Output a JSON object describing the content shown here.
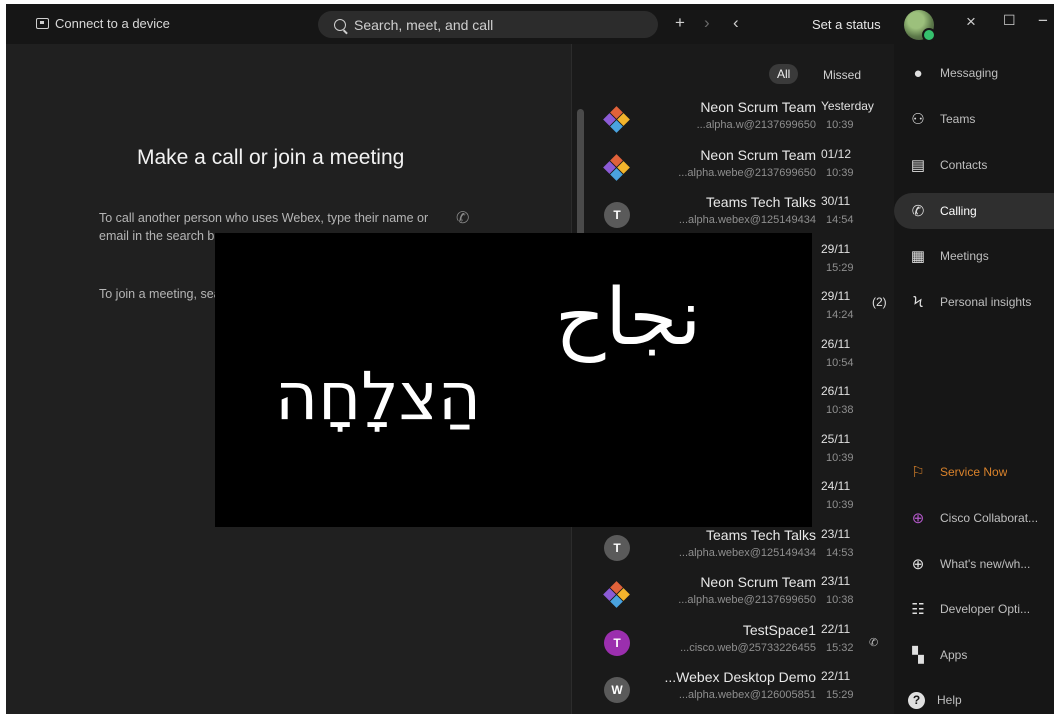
{
  "titlebar": {
    "connect_label": "Connect to a device",
    "search_placeholder": "Search, meet, and call",
    "status_label": "Set a status"
  },
  "left": {
    "heading": "Make a call or join a meeting",
    "para1": "To call another person who uses Webex, type their name or email in the search bar.",
    "para2": "To join a meeting, search bar, such as"
  },
  "calls": {
    "filter_all": "All",
    "filter_missed": "Missed",
    "missed_count": "(2)",
    "rows": [
      {
        "name": "Neon Scrum Team",
        "sub": "...alpha.w@2137699650",
        "date": "Yesterday",
        "time": "10:39",
        "avatar": "logo"
      },
      {
        "name": "Neon Scrum Team",
        "sub": "...alpha.webe@2137699650",
        "date": "01/12",
        "time": "10:39",
        "avatar": "logo"
      },
      {
        "name": "Teams Tech Talks",
        "sub": "...alpha.webex@125149434",
        "date": "30/11",
        "time": "14:54",
        "avatar": "T"
      },
      {
        "name": "",
        "sub": "",
        "date": "29/11",
        "time": "15:29",
        "avatar": ""
      },
      {
        "name": "",
        "sub": "",
        "date": "29/11",
        "time": "14:24",
        "avatar": ""
      },
      {
        "name": "",
        "sub": "",
        "date": "26/11",
        "time": "10:54",
        "avatar": ""
      },
      {
        "name": "",
        "sub": "",
        "date": "26/11",
        "time": "10:38",
        "avatar": ""
      },
      {
        "name": "",
        "sub": "",
        "date": "25/11",
        "time": "10:39",
        "avatar": ""
      },
      {
        "name": "",
        "sub": "",
        "date": "24/11",
        "time": "10:39",
        "avatar": ""
      },
      {
        "name": "Teams Tech Talks",
        "sub": "...alpha.webex@125149434",
        "date": "23/11",
        "time": "14:53",
        "avatar": "T"
      },
      {
        "name": "Neon Scrum Team",
        "sub": "...alpha.webe@2137699650",
        "date": "23/11",
        "time": "10:38",
        "avatar": "logo"
      },
      {
        "name": "TestSpace1",
        "sub": "...cisco.web@25733226455",
        "date": "22/11",
        "time": "15:32",
        "avatar": "T"
      },
      {
        "name": "...Webex Desktop Demo",
        "sub": "...alpha.webex@126005851",
        "date": "22/11",
        "time": "15:29",
        "avatar": "W"
      }
    ]
  },
  "nav": {
    "items": [
      {
        "label": "Messaging",
        "icon": "chat-bubble-icon"
      },
      {
        "label": "Teams",
        "icon": "teams-icon"
      },
      {
        "label": "Contacts",
        "icon": "contacts-icon"
      },
      {
        "label": "Calling",
        "icon": "phone-icon"
      },
      {
        "label": "Meetings",
        "icon": "calendar-icon"
      },
      {
        "label": "Personal insights",
        "icon": "insights-icon"
      },
      {
        "label": "Service Now",
        "icon": "flag-icon"
      },
      {
        "label": "Cisco Collaborat...",
        "icon": "globe-icon"
      },
      {
        "label": "What's new/wh...",
        "icon": "globe-icon"
      },
      {
        "label": "Developer Opti...",
        "icon": "developer-icon"
      },
      {
        "label": "Apps",
        "icon": "apps-icon"
      },
      {
        "label": "Help",
        "icon": "help-icon"
      }
    ]
  },
  "overlay": {
    "arabic": "نجاح",
    "hebrew": "הַצלָחָה"
  },
  "colors": {
    "service_now": "#d9822b",
    "cisco_collab": "#b157c7",
    "accent_green": "#35c06d"
  }
}
